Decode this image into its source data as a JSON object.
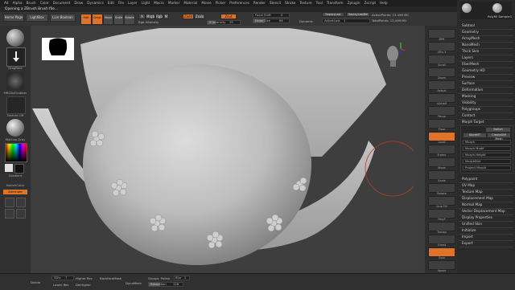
{
  "menubar": {
    "items": [
      "Alt",
      "Alpha",
      "Brush",
      "Color",
      "Document",
      "Draw",
      "Dynamics",
      "Edit",
      "File",
      "Layer",
      "Light",
      "Macro",
      "Marker",
      "Material",
      "Movie",
      "Picker",
      "Preferences",
      "Render",
      "Stencil",
      "Stroke",
      "Texture",
      "Tool",
      "Transform",
      "Zplugin",
      "Zscript",
      "Help"
    ]
  },
  "title": "Opening a ZBrush Brush file...",
  "topshelf": {
    "home_page": "Home Page",
    "lightbox": "LightBox",
    "live_boolean": "Live Boolean",
    "edit": "Edit",
    "draw": "Draw",
    "move": "Move",
    "scale": "Scale",
    "rotate": "Rotate",
    "a_label": "A",
    "mrgb": "Mrgb",
    "rgb": "Rgb",
    "m": "M",
    "zadd": "Zadd",
    "zsub": "Zsub",
    "zcut": "Zcut",
    "rgb_intensity": "Rgb Intensity",
    "z_intensity": "Z Intensity",
    "z_intensity_value": "25",
    "focal_shift": "Focal Shift",
    "focal_shift_value": "0",
    "draw_size": "Draw Size",
    "draw_size_value": "64",
    "dynamic": "Dynamic",
    "replay_last": "ReplayLast",
    "replay_last_rel": "ReplayLastRel",
    "adjust_last": "AdjustLast",
    "adjust_last_value": "1",
    "active_points": "ActivePoints: 13.499 Mil",
    "total_points": "TotalPoints: 13.499 Mil"
  },
  "leftpanel": {
    "items": [
      "Standard",
      "DragRect",
      "MRGBzGrabber",
      "Texture Off",
      "MatCap Gray",
      "Gradient",
      "SwitchColor",
      "Alternate"
    ],
    "accent_color": "#e0732a"
  },
  "rightstrip": {
    "labels": [
      "BPR",
      "SPix 3",
      "Scroll",
      "Zoom",
      "Actual",
      "AAHalf",
      "Persp",
      "Floor",
      "Local",
      "Frame",
      "Move",
      "Scale",
      "Rotate",
      "Line Fill",
      "PolyF",
      "Transp",
      "Ghost",
      "Solo",
      "Xpose"
    ]
  },
  "rightpanel": {
    "header": "Polyfill Sample1",
    "items_top": [
      "Subtool",
      "Geometry",
      "ArrayMesh",
      "NanoMesh",
      "Thick Skin",
      "Layers",
      "FiberMesh",
      "Geometry HD",
      "Preview",
      "Surface",
      "Deformation",
      "Masking",
      "Visibility",
      "Polygroups",
      "Contact",
      "Morph Target"
    ],
    "morph": {
      "switch": "Switch",
      "store_mt": "StoreMT",
      "delete_mt": "DelMT",
      "create_diff_mesh": "CreateDiff Mesh",
      "sliders": [
        "Morph",
        "Morph Modif",
        "Morph Height",
        "MorphDist",
        "Project Morph"
      ]
    },
    "items_bottom": [
      "Polypaint",
      "UV Map",
      "Texture Map",
      "Displacement Map",
      "Normal Map",
      "Vector Displacement Map",
      "Display Properties",
      "Unified Skin",
      "Initialize",
      "Import",
      "Export"
    ]
  },
  "bottombar": {
    "divide": "Divide",
    "sdiv": "SDiv",
    "sdiv_value": "7",
    "lower_res": "Lower Res",
    "higher_res": "Higher Res",
    "del_lower": "DelLower",
    "del_higher": "DelHigher",
    "backface_mask": "BackfaceMask",
    "dynamesh": "DynaMesh",
    "groups": "Groups",
    "polish": "Polish",
    "blur": "Blur",
    "blur_value": "2",
    "resolution": "Resolution",
    "resolution_value": "128"
  }
}
